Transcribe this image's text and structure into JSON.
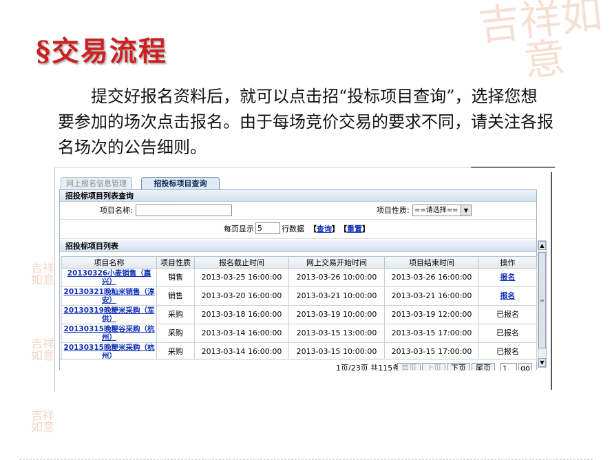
{
  "slide": {
    "title": "§交易流程",
    "body": "提交好报名资料后，就可以点击招“投标项目查询”，选择您想要参加的场次点击报名。由于每场竞价交易的要求不同，请关注各报名场次的公告细则。"
  },
  "tabs": [
    {
      "label": "网上报名信息管理",
      "active": false
    },
    {
      "label": "招投标项目查询",
      "active": true
    }
  ],
  "query_section": {
    "title": "招投标项目列表查询",
    "project_name_label": "项目名称:",
    "project_name_value": "",
    "project_type_label": "项目性质:",
    "project_type_selected": "==请选择==",
    "per_page_label": "每页显示",
    "per_page_value": "5",
    "rows_label": "行数据",
    "query_link": "查询",
    "reset_link": "重置",
    "bracket_open": "【",
    "bracket_close": "】"
  },
  "list_section": {
    "title": "招投标项目列表",
    "columns": [
      "项目名称",
      "项目性质",
      "报名截止时间",
      "网上交易开始时间",
      "项目结束时间",
      "操作"
    ],
    "rows": [
      {
        "name": "20130326小麦销售（嘉兴）",
        "type": "销售",
        "deadline": "2013-03-25 16:00:00",
        "start": "2013-03-26 10:00:00",
        "end": "2013-03-26 16:00:00",
        "op": "报名",
        "op_link": true
      },
      {
        "name": "20130321晚籼米销售（淳安）",
        "type": "销售",
        "deadline": "2013-03-20 16:00:00",
        "start": "2013-03-21 10:00:00",
        "end": "2013-03-21 16:00:00",
        "op": "报名",
        "op_link": true
      },
      {
        "name": "20130319晚粳米采购（军供）",
        "type": "采购",
        "deadline": "2013-03-18 16:00:00",
        "start": "2013-03-19 10:00:00",
        "end": "2013-03-19 12:00:00",
        "op": "已报名",
        "op_link": false
      },
      {
        "name": "20130315晚粳谷采购（杭州）",
        "type": "采购",
        "deadline": "2013-03-14 16:00:00",
        "start": "2013-03-15 13:00:00",
        "end": "2013-03-15 17:00:00",
        "op": "已报名",
        "op_link": false
      },
      {
        "name": "20130315晚粳米采购（杭州）",
        "type": "采购",
        "deadline": "2013-03-14 16:00:00",
        "start": "2013-03-15 10:00:00",
        "end": "2013-03-15 17:00:00",
        "op": "已报名",
        "op_link": false
      }
    ]
  },
  "pager": {
    "info": "1页/23页 共115条",
    "first": "首页",
    "prev": "上页",
    "next": "下页",
    "last": "尾页",
    "page_value": "1",
    "go": "go"
  },
  "decor": {
    "big_seal": "吉祥如意",
    "small_seal": "吉祥如意"
  },
  "colors": {
    "title_red": "#cc1f1f",
    "link_blue": "#1030b8",
    "header_bg": "#d3e0ee"
  }
}
